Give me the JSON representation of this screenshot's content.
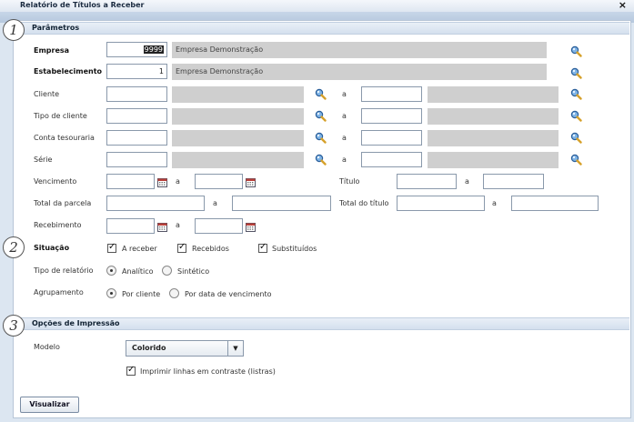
{
  "window": {
    "title": "Relatório de Títulos a Receber",
    "close_label": "×"
  },
  "steps": [
    "1",
    "2",
    "3"
  ],
  "sections": {
    "parametros": "Parâmetros",
    "impressao": "Opções de Impressão"
  },
  "fields": {
    "empresa": {
      "label": "Empresa",
      "code": "9999",
      "name": "Empresa Demonstração"
    },
    "estabelecimento": {
      "label": "Estabelecimento",
      "code": "1",
      "name": "Empresa Demonstração"
    },
    "cliente": {
      "label": "Cliente"
    },
    "tipo_cliente": {
      "label": "Tipo de cliente"
    },
    "conta_tesouraria": {
      "label": "Conta tesouraria"
    },
    "serie": {
      "label": "Série"
    },
    "range_sep": "a",
    "vencimento": {
      "label": "Vencimento"
    },
    "titulo": {
      "label": "Título"
    },
    "total_parcela": {
      "label": "Total da parcela"
    },
    "total_titulo": {
      "label": "Total do título"
    },
    "recebimento": {
      "label": "Recebimento"
    }
  },
  "situacao": {
    "label": "Situação",
    "options": [
      {
        "label": "A receber",
        "checked": true
      },
      {
        "label": "Recebidos",
        "checked": true
      },
      {
        "label": "Substituídos",
        "checked": true
      }
    ]
  },
  "tipo_relatorio": {
    "label": "Tipo de relatório",
    "options": [
      {
        "label": "Analítico",
        "selected": true
      },
      {
        "label": "Sintético",
        "selected": false
      }
    ]
  },
  "agrupamento": {
    "label": "Agrupamento",
    "options": [
      {
        "label": "Por cliente",
        "selected": true
      },
      {
        "label": "Por data de vencimento",
        "selected": false
      }
    ]
  },
  "impressao": {
    "modelo_label": "Modelo",
    "modelo_value": "Colorido",
    "contraste_label": "Imprimir linhas em contraste (listras)",
    "contraste_checked": true
  },
  "actions": {
    "visualizar": "Visualizar"
  },
  "icons": {
    "lookup": "magnifier-icon",
    "calendar": "calendar-icon",
    "dropdown": "chevron-down-icon",
    "close": "close-icon"
  },
  "colors": {
    "accent": "#dce6f1",
    "readonly": "#cfcfcf",
    "panel": "#ffffff"
  }
}
